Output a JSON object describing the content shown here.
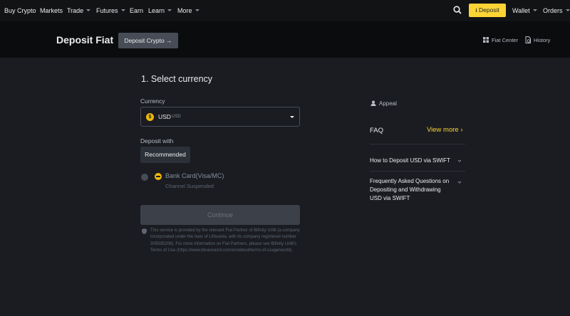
{
  "topnav": {
    "items": [
      {
        "label": "Buy Crypto",
        "caret": false
      },
      {
        "label": "Markets",
        "caret": false
      },
      {
        "label": "Trade",
        "caret": true
      },
      {
        "label": "Futures",
        "caret": true
      },
      {
        "label": "Earn",
        "caret": false
      },
      {
        "label": "Learn",
        "caret": true
      },
      {
        "label": "More",
        "caret": true
      }
    ],
    "search_icon": "search-icon",
    "deposit_label": "Deposit",
    "deposit_icon": "download-icon",
    "wallet_label": "Wallet",
    "orders_label": "Orders"
  },
  "header": {
    "title": "Deposit Fiat",
    "crypto_button": "Deposit Crypto →",
    "fiat_center": "Fiat Center",
    "history": "History"
  },
  "form": {
    "step_title": "1. Select currency",
    "currency_label": "Currency",
    "currency": {
      "code": "USD",
      "sub": "USD",
      "icon_glyph": "$"
    },
    "deposit_with_label": "Deposit with",
    "recommended_tab": "Recommended",
    "method": {
      "name": "Bank Card(Visa/MC)",
      "status": "Channel Suspended"
    },
    "continue_label": "Continue",
    "disclaimer": "This service is provided by the relevant Fiat Partner of Bifinity UAB (a company incorporated under the laws of Lithuania, with its company registered number 305595206). For more information on Fiat Partners, please see Bifinity UAB's Terms of Use (https://www.binancecnt.com/en/about/terms-of-usage/world)."
  },
  "side": {
    "appeal": "Appeal",
    "faq_title": "FAQ",
    "view_more": "View more ›",
    "faq_items": [
      "How to Deposit USD via SWIFT",
      "Frequently Asked Questions on Depositing and Withdrawing USD via SWIFT"
    ]
  },
  "colors": {
    "background": "#1a1c21",
    "topnav": "#121315",
    "header": "#0b0c0e",
    "accent": "#fcd535"
  }
}
